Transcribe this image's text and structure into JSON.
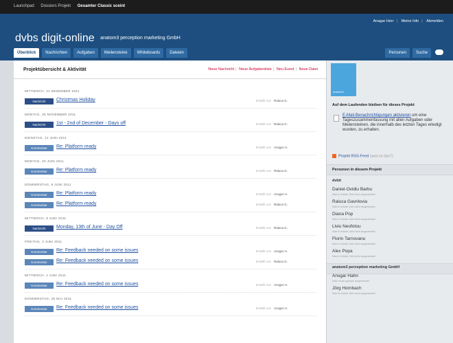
{
  "topbar": {
    "links": [
      "Launchpad",
      "Dossiers Projekt",
      "Gesamter Classic sceint"
    ]
  },
  "header": {
    "user_links": [
      "Anagar Herr",
      "Meine Info",
      "Abmelden"
    ],
    "app_name": "dvbs digit-online",
    "company": "anatom3 perception marketing GmbH",
    "tabs": [
      "Überblick",
      "Nachrichten",
      "Aufgaben",
      "Meilensteine",
      "Whiteboards",
      "Dateien"
    ],
    "right_tabs": [
      "Personen",
      "Suche"
    ]
  },
  "main": {
    "title": "Projektübersicht & Aktivität",
    "new_links": [
      "Neue Nachricht",
      "Neue Aufgabenliste",
      "Neu Event",
      "Neue Datei"
    ],
    "days": [
      {
        "date": "MITTWOCH, 21 DEZEMBER 2011",
        "items": [
          {
            "type": "Nachricht",
            "style": "dark",
            "title": "Christmas Holiday",
            "by": "Erstellt von",
            "person": "Raluca G."
          }
        ]
      },
      {
        "date": "MONTAG, 26 NOVEMBER 2011",
        "items": [
          {
            "type": "Nachricht",
            "style": "dark",
            "title": "1st - 2nd of December - Days off",
            "by": "Erstellt von",
            "person": "Raluca G."
          }
        ]
      },
      {
        "date": "DIENSTAG, 21 JUNI 2011",
        "items": [
          {
            "type": "Kommentar",
            "style": "light",
            "title": "Re: Platform ready",
            "by": "Erstellt von",
            "person": "Ansgar H."
          }
        ]
      },
      {
        "date": "MONTAG, 20 JUNI 2011",
        "items": [
          {
            "type": "Kommentar",
            "style": "light",
            "title": "Re: Platform ready",
            "by": "Erstellt von",
            "person": "Raluca G."
          }
        ]
      },
      {
        "date": "DONNERSTAG, 9 JUNI 2011",
        "items": [
          {
            "type": "Kommentar",
            "style": "light",
            "title": "Re: Platform ready",
            "by": "Erstellt von",
            "person": "Ansgar H."
          },
          {
            "type": "Kommentar",
            "style": "light",
            "title": "Re: Platform ready",
            "by": "Erstellt von",
            "person": "Raluca G."
          }
        ]
      },
      {
        "date": "MITTWOCH, 8 JUNI 2011",
        "items": [
          {
            "type": "Nachricht",
            "style": "dark",
            "title": "Monday, 13th of June - Day Off",
            "by": "Erstellt von",
            "person": "Raluca G."
          }
        ]
      },
      {
        "date": "FREITAG, 3 JUNI 2011",
        "items": [
          {
            "type": "Kommentar",
            "style": "light",
            "title": "Re: Feedback needed on some issues",
            "by": "Erstellt von",
            "person": "Ansgar H."
          },
          {
            "type": "Kommentar",
            "style": "light",
            "title": "Re: Feedback needed on some issues",
            "by": "Erstellt von",
            "person": "Raluca G."
          }
        ]
      },
      {
        "date": "MITTWOCH, 1 JUNI 2011",
        "items": [
          {
            "type": "Kommentar",
            "style": "light",
            "title": "Re: Feedback needed on some issues",
            "by": "Erstellt von",
            "person": "Ansgar H."
          }
        ]
      },
      {
        "date": "DONNERSTAG, 26 MAI 2011",
        "items": [
          {
            "type": "Kommentar",
            "style": "light",
            "title": "Re: Feedback needed on some issues",
            "by": "Erstellt von",
            "person": "Ansgar H."
          }
        ]
      }
    ]
  },
  "sidebar": {
    "logo_text": "anatom3",
    "info_heading": "Auf dem Laufenden bleiben für dieses Projekt",
    "info_link": "E-Mail-Benachrichtigungen aktivieren",
    "info_rest": " um eine Tageszusammenfassung mit allen Aufgaben oder Meilensteinen, die innerhalb des letzten Tages erledigt wurden, zu erhalten.",
    "rss_label": "Projekt RSS-Feed",
    "rss_note": "(was ist das?)",
    "people_heading": "Personen in diesem Projekt",
    "orgs": [
      {
        "name": "dvbit",
        "members": [
          {
            "name": "Daniel-Ovidiu Barbu",
            "status": "War in letzter Zeit nicht angemeldet"
          },
          {
            "name": "Raluca Gavrilovia",
            "status": "War in letzter Zeit nicht angemeldet"
          },
          {
            "name": "Diana Pop",
            "status": "War in letzter Zeit nicht angemeldet"
          },
          {
            "name": "Liviu Neofotou",
            "status": "War in letzter Zeit nicht angemeldet"
          },
          {
            "name": "Florin Tarnovanu",
            "status": "War in letzter Zeit nicht angemeldet"
          },
          {
            "name": "Alex Popa",
            "status": "War in letzter Zeit nicht angemeldet"
          }
        ]
      },
      {
        "name": "anatom3 perception marketing GmbH",
        "members": [
          {
            "name": "Ansgar Hahn",
            "status": "War heute gerade angemeldet"
          },
          {
            "name": "Jörg Hornbach",
            "status": "War in letzter Zeit nicht angemeldet"
          }
        ]
      }
    ]
  }
}
